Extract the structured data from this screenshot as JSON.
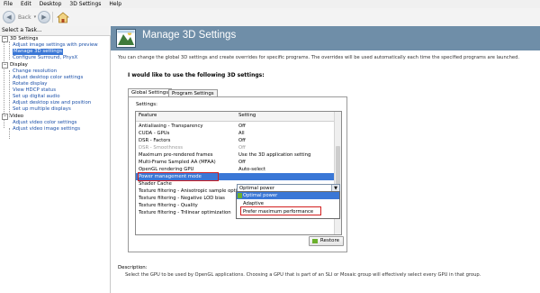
{
  "menu": [
    "File",
    "Edit",
    "Desktop",
    "3D Settings",
    "Help"
  ],
  "toolbar": {
    "back_label": "Back",
    "back_icon": "arrow-left-icon",
    "forward_icon": "arrow-right-icon",
    "home_icon": "home-icon"
  },
  "left_panel": {
    "header": "Select a Task...",
    "categories": [
      {
        "label": "3D Settings",
        "items": [
          "Adjust image settings with preview",
          "Manage 3D settings",
          "Configure Surround, PhysX"
        ]
      },
      {
        "label": "Display",
        "items": [
          "Change resolution",
          "Adjust desktop color settings",
          "Rotate display",
          "View HDCP status",
          "Set up digital audio",
          "Adjust desktop size and position",
          "Set up multiple displays"
        ]
      },
      {
        "label": "Video",
        "items": [
          "Adjust video color settings",
          "Adjust video image settings"
        ]
      }
    ],
    "selected_item": "Manage 3D settings"
  },
  "page": {
    "title": "Manage 3D Settings",
    "intro": "You can change the global 3D settings and create overrides for specific programs. The overrides will be used automatically each time the specified programs are launched.",
    "subtitle": "I would like to use the following 3D settings:",
    "tabs": [
      "Global Settings",
      "Program Settings"
    ],
    "settings_label": "Settings:",
    "columns": {
      "feature": "Feature",
      "setting": "Setting"
    },
    "rows": [
      {
        "feature": "Antialiasing - Transparency",
        "value": "Off",
        "dim": false
      },
      {
        "feature": "CUDA - GPUs",
        "value": "All",
        "dim": false
      },
      {
        "feature": "DSR - Factors",
        "value": "Off",
        "dim": false
      },
      {
        "feature": "DSR - Smoothness",
        "value": "Off",
        "dim": true
      },
      {
        "feature": "Maximum pre-rendered frames",
        "value": "Use the 3D application setting",
        "dim": false
      },
      {
        "feature": "Multi-Frame Sampled AA (MFAA)",
        "value": "Off",
        "dim": false
      },
      {
        "feature": "OpenGL rendering GPU",
        "value": "Auto-select",
        "dim": false
      },
      {
        "feature": "Power management mode",
        "value": "",
        "dim": false,
        "selected": true
      },
      {
        "feature": "Shader Cache",
        "value": "",
        "dim": false
      },
      {
        "feature": "Texture filtering - Anisotropic sample opti...",
        "value": "",
        "dim": false
      },
      {
        "feature": "Texture filtering - Negative LOD bias",
        "value": "",
        "dim": false
      },
      {
        "feature": "Texture filtering - Quality",
        "value": "Quality",
        "dim": false
      },
      {
        "feature": "Texture filtering - Trilinear optimization",
        "value": "",
        "dim": false
      }
    ],
    "combo_value": "Optimal power",
    "dropdown_options": [
      "Optimal power",
      "Adaptive",
      "Prefer maximum performance"
    ],
    "restore_label": "Restore",
    "description_label": "Description:",
    "description_text": "Select the GPU to be used by OpenGL applications. Choosing a GPU that is part of an SLI or Mosaic group will effectively select every GPU in that group."
  },
  "colors": {
    "header": "#6f8ea8",
    "selection": "#3a77d6",
    "link": "#1a4fa8",
    "highlight_box": "#d21f1f",
    "nvidia_green": "#6cb02d"
  }
}
